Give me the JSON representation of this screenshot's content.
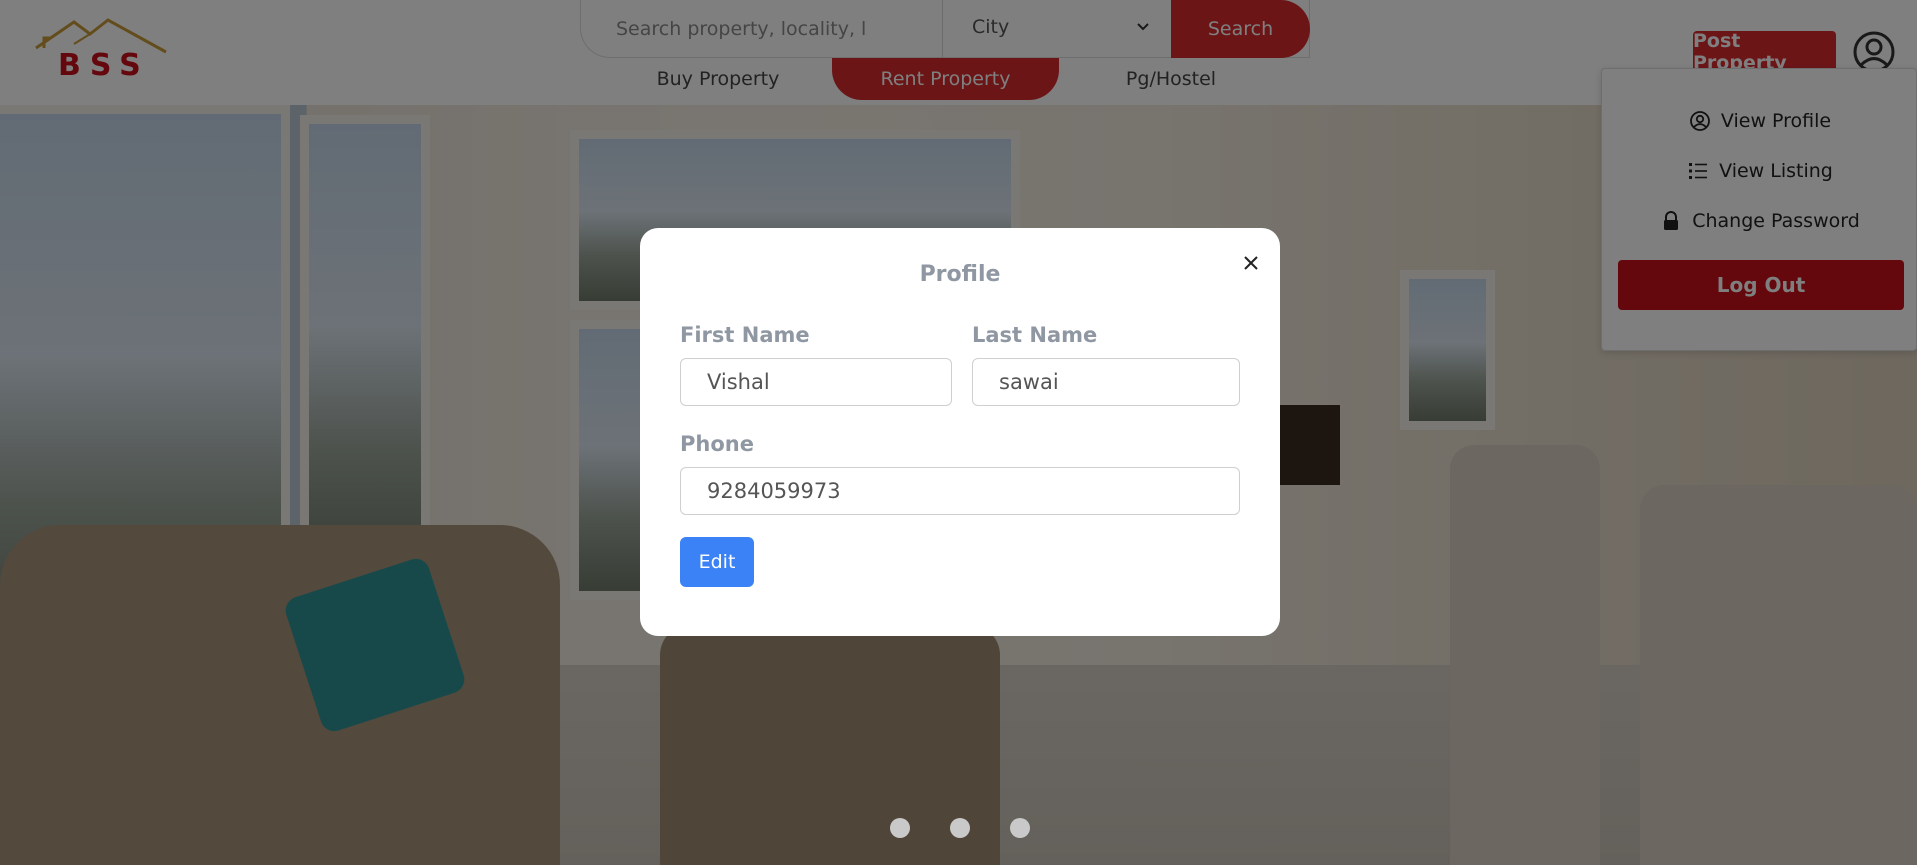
{
  "brand": {
    "logo_text": "BSS",
    "accent_color": "#d92b2f"
  },
  "header": {
    "search_placeholder": "Search property, locality, l",
    "city_label": "City",
    "search_button": "Search",
    "tabs": [
      {
        "label": "Buy Property",
        "active": false
      },
      {
        "label": "Rent Property",
        "active": true
      },
      {
        "label": "Pg/Hostel",
        "active": false
      }
    ],
    "post_property_button": "Post Property",
    "avatar_icon": "user-circle-icon"
  },
  "dropdown": {
    "items": [
      {
        "label": "View Profile",
        "icon": "user-circle-icon"
      },
      {
        "label": "View Listing",
        "icon": "list-icon"
      },
      {
        "label": "Change Password",
        "icon": "lock-icon"
      }
    ],
    "logout_button": "Log Out"
  },
  "modal": {
    "title": "Profile",
    "first_name_label": "First Name",
    "first_name_value": "Vishal",
    "last_name_label": "Last Name",
    "last_name_value": "sawai",
    "phone_label": "Phone",
    "phone_value": "9284059973",
    "edit_button": "Edit"
  },
  "carousel": {
    "slide_count": 3
  }
}
